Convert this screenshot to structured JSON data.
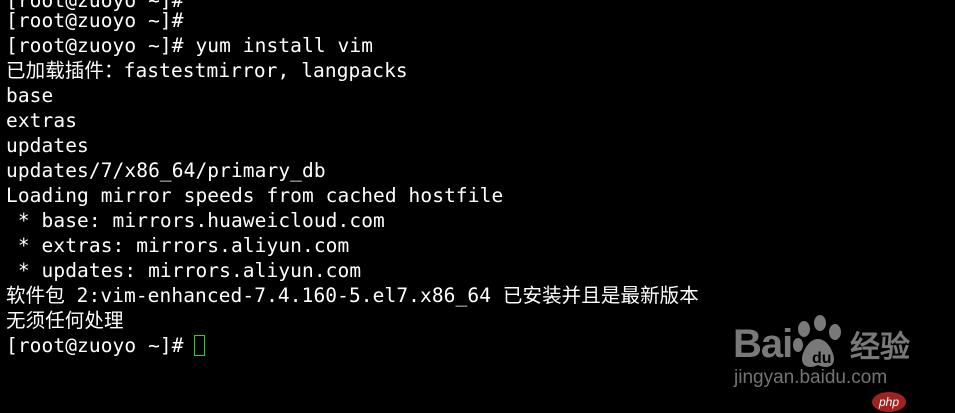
{
  "terminal": {
    "lines": [
      "[root@zuoyo ~]#",
      "[root@zuoyo ~]#",
      "[root@zuoyo ~]# yum install vim",
      "已加载插件：fastestmirror, langpacks",
      "base",
      "extras",
      "updates",
      "updates/7/x86_64/primary_db",
      "Loading mirror speeds from cached hostfile",
      " * base: mirrors.huaweicloud.com",
      " * extras: mirrors.aliyun.com",
      " * updates: mirrors.aliyun.com",
      "软件包 2:vim-enhanced-7.4.160-5.el7.x86_64 已安装并且是最新版本",
      "无须任何处理",
      "[root@zuoyo ~]#"
    ],
    "text_color": "#ffffff",
    "background": "#000000",
    "cursor_color": "#22d322"
  },
  "watermark": {
    "brand": "Bai",
    "brand_suffix": "经验",
    "url": "jingyan.baidu.com",
    "badge": "php"
  }
}
